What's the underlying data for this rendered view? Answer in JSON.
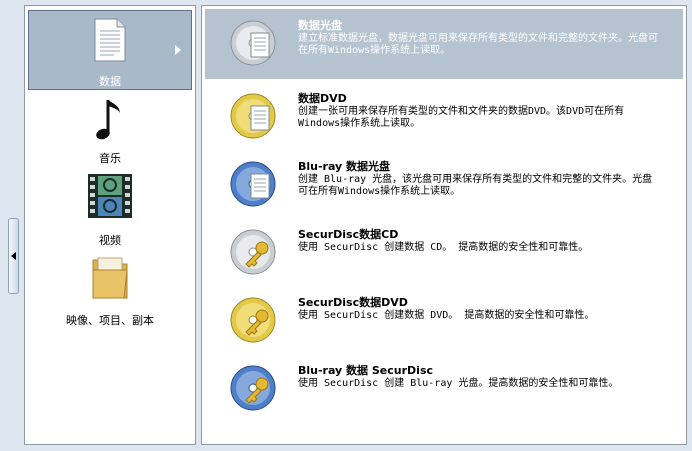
{
  "categories": [
    {
      "label": "数据",
      "icon": "document-icon",
      "selected": true
    },
    {
      "label": "音乐",
      "icon": "music-note-icon"
    },
    {
      "label": "视频",
      "icon": "film-icon"
    },
    {
      "label": "映像、项目、副本",
      "icon": "folder-icon"
    }
  ],
  "items": [
    {
      "title": "数据光盘",
      "desc": "建立标准数据光盘，数据光盘可用来保存所有类型的文件和完整的文件夹。光盘可在所有Windows操作系统上读取。",
      "icon": "data-cd-icon",
      "selected": true
    },
    {
      "title": "数据DVD",
      "desc": "创建一张可用来保存所有类型的文件和文件夹的数据DVD。该DVD可在所有Windows操作系统上读取。",
      "icon": "data-dvd-icon"
    },
    {
      "title": "Blu-ray 数据光盘",
      "desc": "创建 Blu-ray 光盘，该光盘可用来保存所有类型的文件和完整的文件夹。光盘可在所有Windows操作系统上读取。",
      "icon": "bluray-icon"
    },
    {
      "title": "SecurDisc数据CD",
      "desc": "使用 SecurDisc 创建数据 CD。 提高数据的安全性和可靠性。",
      "icon": "securdisc-cd-icon"
    },
    {
      "title": "SecurDisc数据DVD",
      "desc": "使用 SecurDisc 创建数据 DVD。 提高数据的安全性和可靠性。",
      "icon": "securdisc-dvd-icon"
    },
    {
      "title": "Blu-ray 数据 SecurDisc",
      "desc": "使用 SecurDisc 创建 Blu-ray 光盘。提高数据的安全性和可靠性。",
      "icon": "securdisc-bluray-icon"
    }
  ]
}
